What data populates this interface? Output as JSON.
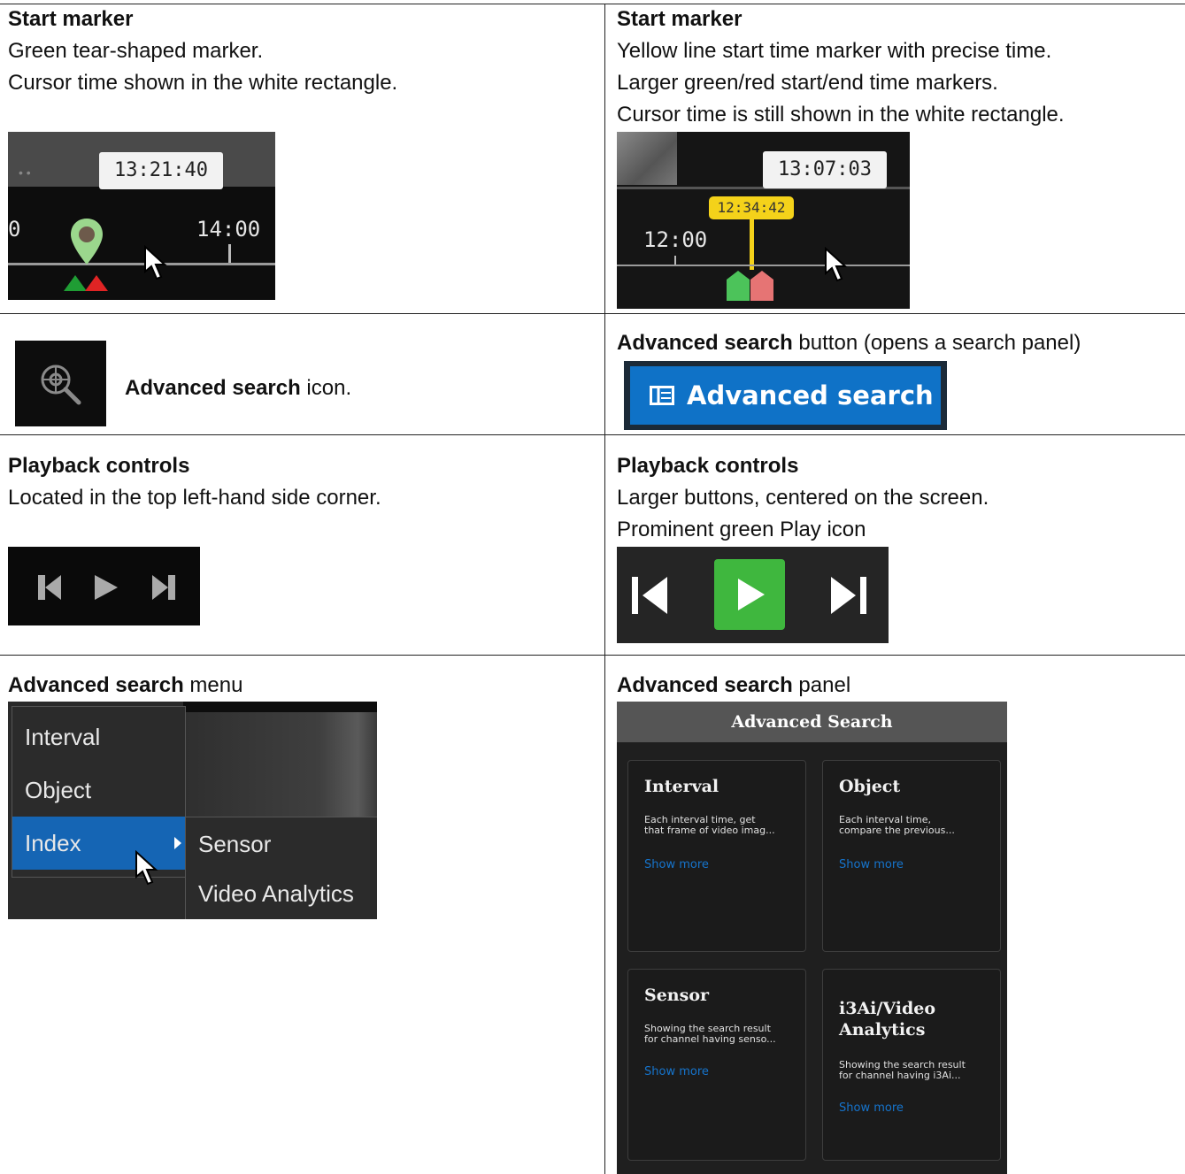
{
  "row1": {
    "left": {
      "heading": "Start marker",
      "lines": [
        "Green tear-shaped marker.",
        "Cursor time shown in the white rectangle."
      ],
      "shot": {
        "cursor_time": "13:21:40",
        "tick_left": "0",
        "tick_right": "14:00"
      }
    },
    "right": {
      "heading": "Start marker",
      "lines": [
        "Yellow line start time marker with precise time.",
        "Larger green/red start/end time markers.",
        "Cursor time is still shown in the white rectangle."
      ],
      "shot": {
        "cursor_time": "13:07:03",
        "start_time": "12:34:42",
        "tick_left": "12:00"
      }
    }
  },
  "row2": {
    "left": {
      "bold": "Advanced search",
      "text": " icon.",
      "icon": "search-target-icon"
    },
    "right": {
      "bold": "Advanced search",
      "text": " button (opens a search panel)",
      "button_label": "Advanced search",
      "button_icon": "panel-icon",
      "colors": {
        "button": "#0f72c7"
      }
    }
  },
  "row3": {
    "left": {
      "heading": "Playback controls",
      "lines": [
        "Located in the top left-hand side corner."
      ]
    },
    "right": {
      "heading": "Playback controls",
      "lines": [
        "Larger buttons, centered on the screen.",
        "Prominent green Play icon"
      ],
      "colors": {
        "play": "#3fb73e"
      }
    }
  },
  "row4": {
    "left": {
      "bold": "Advanced search",
      "text": " menu",
      "menu": {
        "items": [
          "Interval",
          "Object",
          "Index"
        ],
        "sub_items": [
          "Sensor",
          "Video Analytics"
        ]
      }
    },
    "right": {
      "bold": "Advanced search",
      "text": " panel",
      "panel": {
        "title": "Advanced Search",
        "cards": [
          {
            "title": "Interval",
            "desc": "Each interval time, get\nthat frame of video imag...",
            "more": "Show more"
          },
          {
            "title": "Object",
            "desc": "Each interval time,\ncompare the previous...",
            "more": "Show more"
          },
          {
            "title": "Sensor",
            "desc": "Showing the search result\nfor channel having senso...",
            "more": "Show more"
          },
          {
            "title": "i3Ai/Video\nAnalytics",
            "desc": "Showing the search result\nfor channel having i3Ai...",
            "more": "Show more"
          }
        ]
      }
    }
  }
}
